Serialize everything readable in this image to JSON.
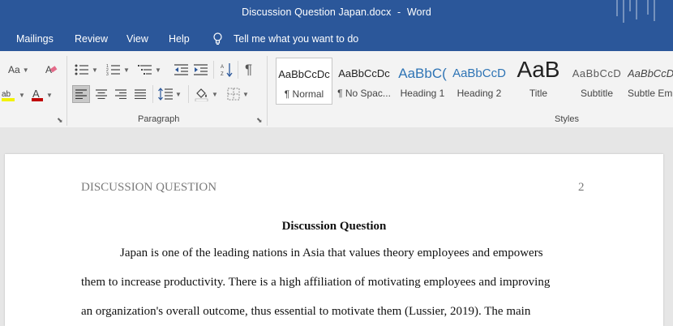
{
  "window": {
    "doc_name": "Discussion Question Japan.docx",
    "separator": "-",
    "app_name": "Word"
  },
  "tabs": {
    "mailings": "Mailings",
    "review": "Review",
    "view": "View",
    "help": "Help",
    "tell_me": "Tell me what you want to do"
  },
  "ribbon": {
    "font_case_label": "Aa",
    "paragraph_label": "Paragraph",
    "styles_label": "Styles",
    "highlight_color": "#f2f200",
    "font_color": "#c00000",
    "styles": [
      {
        "preview": "AaBbCcDc",
        "name": "¶ Normal"
      },
      {
        "preview": "AaBbCcDc",
        "name": "¶ No Spac..."
      },
      {
        "preview": "AaBbC(",
        "name": "Heading 1"
      },
      {
        "preview": "AaBbCcD",
        "name": "Heading 2"
      },
      {
        "preview": "AaB",
        "name": "Title"
      },
      {
        "preview": "AaBbCcD",
        "name": "Subtitle"
      },
      {
        "preview": "AaBbCcDc",
        "name": "Subtle Em"
      }
    ]
  },
  "document": {
    "header_left": "DISCUSSION QUESTION",
    "header_right": "2",
    "title": "Discussion Question",
    "lines": [
      "Japan is one of the leading nations in Asia that values theory employees and empowers",
      "them to increase productivity. There is a high affiliation of motivating employees and improving",
      "an organization's overall outcome, thus essential to motivate them (Lussier, 2019). The main"
    ]
  },
  "colors": {
    "ribbon_blue": "#2b579a",
    "heading_blue": "#2e74b5"
  }
}
